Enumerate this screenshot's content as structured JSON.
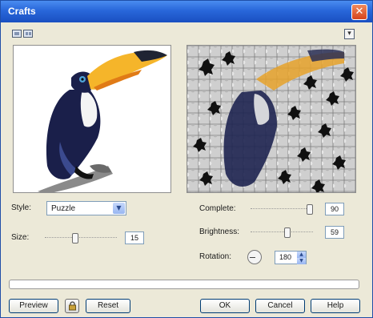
{
  "window": {
    "title": "Crafts"
  },
  "toolbar": {
    "single_preview_icon": "single-preview-icon",
    "split_preview_icon": "split-preview-icon",
    "collapse_icon": "collapse-icon"
  },
  "controls": {
    "style": {
      "label": "Style:",
      "value": "Puzzle"
    },
    "size": {
      "label": "Size:",
      "value": "15",
      "level": 0.42
    },
    "complete": {
      "label": "Complete:",
      "value": "90",
      "level": 0.95
    },
    "brightness": {
      "label": "Brightness:",
      "value": "59",
      "level": 0.59
    },
    "rotation": {
      "label": "Rotation:",
      "value": "180"
    }
  },
  "buttons": {
    "preview": "Preview",
    "reset": "Reset",
    "ok": "OK",
    "cancel": "Cancel",
    "help": "Help"
  },
  "progress": 0,
  "colors": {
    "titlebar": "#2867da",
    "accent_blue": "#7f9db9",
    "toucan_beak": "#f5b52a",
    "toucan_body": "#1a1f4a"
  }
}
